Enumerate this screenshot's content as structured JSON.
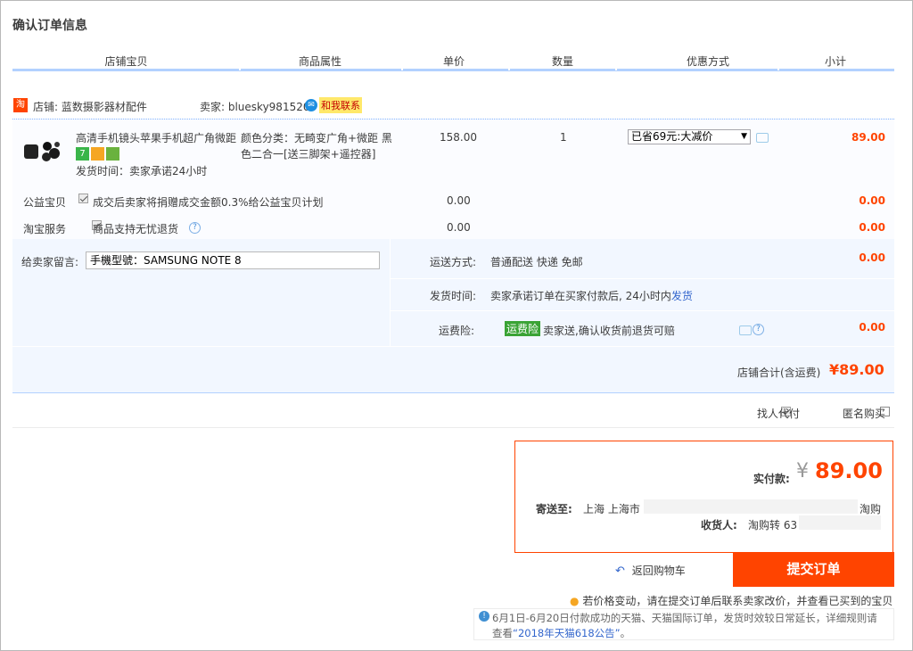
{
  "page_title": "确认订单信息",
  "table_headers": [
    "店铺宝贝",
    "商品属性",
    "单价",
    "数量",
    "优惠方式",
    "小计"
  ],
  "shop": {
    "icon_text": "淘",
    "shop_label": "店铺: 蓝数摄影器材配件",
    "seller_label": "卖家: bluesky981520",
    "chat_label": "和我联系"
  },
  "product": {
    "title": "高清手机镜头苹果手机超广角微距",
    "attributes": "颜色分类：无畸变广角+微距 黑色二合一[送三脚架+遥控器]",
    "ship_time": "发货时间：卖家承诺24小时",
    "service_icons": [
      {
        "text": "7",
        "color": "#3ab54a"
      },
      {
        "text": "",
        "color": "#f5a623"
      },
      {
        "text": "",
        "color": "#6ab23e"
      }
    ],
    "price": "158.00",
    "quantity": "1",
    "discount_selected": "已省69元:大减价",
    "subtotal": "89.00"
  },
  "charity": {
    "label": "公益宝贝",
    "desc": "成交后卖家将捐赠成交金额0.3%给公益宝贝计划",
    "price": "0.00",
    "subtotal": "0.00"
  },
  "taobao_service": {
    "label": "淘宝服务",
    "desc": "商品支持无忧退货",
    "price": "0.00",
    "subtotal": "0.00"
  },
  "message": {
    "label": "给卖家留言:",
    "value": "手機型號：SAMSUNG NOTE 8"
  },
  "shipping": {
    "method_label": "运送方式:",
    "method_value": "普通配送 快递 免邮",
    "method_cost": "0.00",
    "time_label": "发货时间:",
    "time_value": "卖家承诺订单在买家付款后, 24小时内",
    "time_link": "发货",
    "insurance_label": "运费险:",
    "insurance_badge": "运费险",
    "insurance_desc": "卖家送,确认收货前退货可赔",
    "insurance_cost": "0.00"
  },
  "store_total": {
    "label": "店铺合计(含运费)",
    "value": "¥89.00"
  },
  "options": {
    "proxy_pay": "找人代付",
    "anonymous": "匿名购买"
  },
  "payment": {
    "actual_label": "实付款:",
    "currency": "¥",
    "amount": "89.00",
    "ship_to_label": "寄送至:",
    "ship_to_value": "上海 上海市",
    "ship_to_suffix": "淘购",
    "receiver_label": "收货人:",
    "receiver_value": "淘购转 63"
  },
  "actions": {
    "back_label": "返回购物车",
    "submit_label": "提交订单"
  },
  "notices": {
    "price_change": "若价格变动，请在提交订单后联系卖家改价，并查看已买到的宝贝",
    "promo_line1": "6月1日-6月20日付款成功的天猫、天猫国际订单，发货时效较日常延长，详细规则请",
    "promo_line2_prefix": "查看",
    "promo_link": "“2018年天猫618公告”",
    "promo_line2_suffix": "。"
  },
  "colors": {
    "accent": "#ff4400",
    "header_border": "#b2d1ff",
    "light_blue_bg": "#f2f7ff",
    "link": "#3366cc"
  }
}
